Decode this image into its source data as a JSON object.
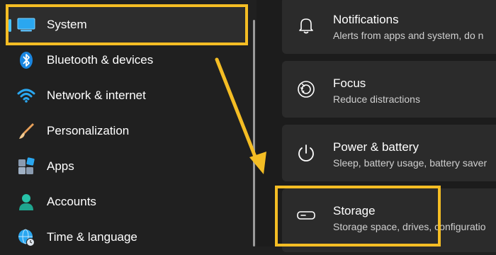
{
  "sidebar": {
    "items": [
      {
        "label": "System",
        "icon": "monitor-icon"
      },
      {
        "label": "Bluetooth & devices",
        "icon": "bluetooth-icon"
      },
      {
        "label": "Network & internet",
        "icon": "wifi-icon"
      },
      {
        "label": "Personalization",
        "icon": "paintbrush-icon"
      },
      {
        "label": "Apps",
        "icon": "apps-icon"
      },
      {
        "label": "Accounts",
        "icon": "person-icon"
      },
      {
        "label": "Time & language",
        "icon": "globe-clock-icon"
      }
    ]
  },
  "main": {
    "cards": [
      {
        "title": "Notifications",
        "desc": "Alerts from apps and system, do n",
        "icon": "bell-icon"
      },
      {
        "title": "Focus",
        "desc": "Reduce distractions",
        "icon": "focus-icon"
      },
      {
        "title": "Power & battery",
        "desc": "Sleep, battery usage, battery saver",
        "icon": "power-icon"
      },
      {
        "title": "Storage",
        "desc": "Storage space, drives, configuratio",
        "icon": "storage-drive-icon"
      }
    ]
  },
  "colors": {
    "highlight": "#f4bd24",
    "accent": "#4cc2ff",
    "background": "#202020",
    "card": "#2b2b2b"
  }
}
